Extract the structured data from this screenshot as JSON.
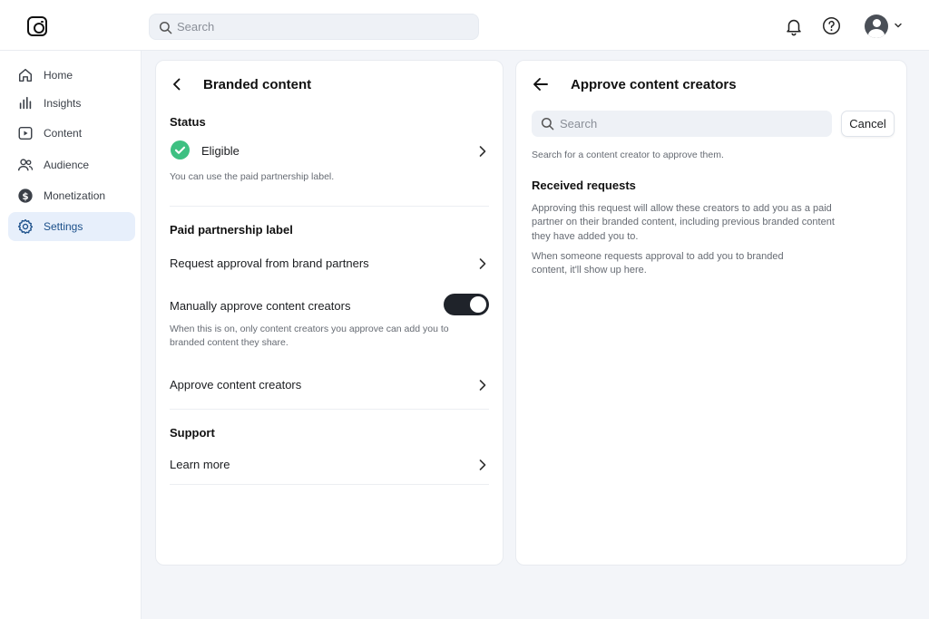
{
  "topbar": {
    "search_placeholder": "Search",
    "icons": [
      "instagram-logo",
      "search-icon",
      "bell-icon",
      "help-icon",
      "avatar",
      "chevron-down-icon"
    ]
  },
  "sidebar": {
    "items": [
      {
        "label": "Home",
        "icon": "home-icon",
        "active": false
      },
      {
        "label": "Insights",
        "icon": "bar-chart-icon",
        "active": false
      },
      {
        "label": "Content",
        "icon": "play-icon",
        "active": false
      },
      {
        "label": "Audience",
        "icon": "people-icon",
        "active": false
      },
      {
        "label": "Monetization",
        "icon": "dollar-icon",
        "active": false
      },
      {
        "label": "Settings",
        "icon": "gear-icon",
        "active": true
      }
    ]
  },
  "left_panel": {
    "title": "Branded content",
    "status": {
      "heading": "Status",
      "value": "Eligible",
      "note": "You can use the paid partnership label."
    },
    "paid_partnership": {
      "heading": "Paid partnership label",
      "request_approval": "Request approval from brand partners",
      "manual_approve": "Manually approve content creators",
      "manual_approve_on": true,
      "manual_note_1": "When this is on, only content creators you approve can add you to",
      "manual_note_2": "branded content they share.",
      "approve_creators": "Approve content creators"
    },
    "support": {
      "heading": "Support",
      "learn_more": "Learn more"
    }
  },
  "right_panel": {
    "title": "Approve content creators",
    "search_placeholder": "Search",
    "cancel_label": "Cancel",
    "search_hint": "Search for a content creator to approve them.",
    "received_heading": "Received requests",
    "received_p1_l1": "Approving this request will allow these creators to add you as a paid",
    "received_p1_l2": "partner on their branded content, including previous branded content",
    "received_p1_l3": "they have added you to.",
    "received_p2_l1": "When someone requests approval to add you to branded",
    "received_p2_l2": "content, it'll show up here."
  },
  "colors": {
    "accent": "#1b4f8a",
    "active_bg": "#e7effb",
    "eligible_green": "#3ec082",
    "toggle_on": "#1f232a",
    "page_bg": "#f3f5f9"
  }
}
